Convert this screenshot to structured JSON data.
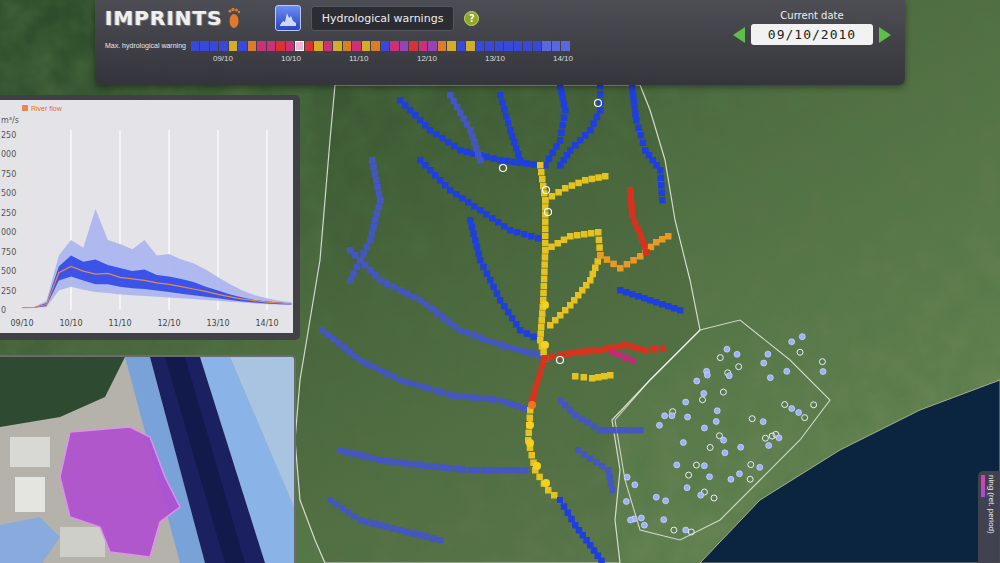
{
  "app": {
    "logo": "IMPRINTS"
  },
  "toolbar": {
    "layer_button": {
      "selected": true
    },
    "layer_menu": "Hydrological warnings",
    "help": "?"
  },
  "timeline": {
    "label": "Max. hydrological warning",
    "cells": [
      {
        "color": "#3848d8",
        "selected": false
      },
      {
        "color": "#3848d8",
        "selected": false
      },
      {
        "color": "#3848d8",
        "selected": false
      },
      {
        "color": "#3848d8",
        "selected": false
      },
      {
        "color": "#d2ae28",
        "selected": false
      },
      {
        "color": "#3848d8",
        "selected": false
      },
      {
        "color": "#dc7c24",
        "selected": false
      },
      {
        "color": "#cc3078",
        "selected": false
      },
      {
        "color": "#cc3078",
        "selected": false
      },
      {
        "color": "#d83234",
        "selected": false
      },
      {
        "color": "#cc3078",
        "selected": false
      },
      {
        "color": "#f0b4d4",
        "selected": true
      },
      {
        "color": "#d83234",
        "selected": false
      },
      {
        "color": "#d2ae28",
        "selected": false
      },
      {
        "color": "#cc3078",
        "selected": false
      },
      {
        "color": "#d2ae28",
        "selected": false
      },
      {
        "color": "#dc7c24",
        "selected": false
      },
      {
        "color": "#cc3078",
        "selected": false
      },
      {
        "color": "#d2ae28",
        "selected": false
      },
      {
        "color": "#dc7c24",
        "selected": false
      },
      {
        "color": "#3848d8",
        "selected": false
      },
      {
        "color": "#cc3078",
        "selected": false
      },
      {
        "color": "#9444b4",
        "selected": false
      },
      {
        "color": "#d83234",
        "selected": false
      },
      {
        "color": "#cc3078",
        "selected": false
      },
      {
        "color": "#9444b4",
        "selected": false
      },
      {
        "color": "#dc7c24",
        "selected": false
      },
      {
        "color": "#d2ae28",
        "selected": false
      },
      {
        "color": "#3848d8",
        "selected": false
      },
      {
        "color": "#d2ae28",
        "selected": false
      },
      {
        "color": "#3848d8",
        "selected": false
      },
      {
        "color": "#3848d8",
        "selected": false
      },
      {
        "color": "#3848d8",
        "selected": false
      },
      {
        "color": "#3848d8",
        "selected": false
      },
      {
        "color": "#3848d8",
        "selected": false
      },
      {
        "color": "#3848d8",
        "selected": false
      },
      {
        "color": "#3848d8",
        "selected": false
      },
      {
        "color": "#5a68dc",
        "selected": false
      },
      {
        "color": "#5a68dc",
        "selected": false
      },
      {
        "color": "#5a68dc",
        "selected": false
      }
    ],
    "ticks": [
      "09/10",
      "10/10",
      "11/10",
      "12/10",
      "13/10",
      "14/10"
    ]
  },
  "date": {
    "label": "Current date",
    "value": "09/10/2010"
  },
  "chart": {
    "legend": "River flow",
    "unit": "m³/s",
    "y_ticks": [
      "250",
      "000",
      "750",
      "500",
      "250",
      "000",
      "750",
      "500",
      "250",
      "0"
    ],
    "x_ticks": [
      "09/10",
      "10/10",
      "11/10",
      "12/10",
      "13/10",
      "14/10"
    ],
    "bands": [
      {
        "color": "#aab4f0",
        "upper": [
          30,
          40,
          120,
          700,
          900,
          800,
          1300,
          900,
          850,
          780,
          900,
          700,
          720,
          650,
          600,
          520,
          420,
          330,
          250,
          190,
          150,
          120,
          100
        ],
        "lower": [
          30,
          28,
          40,
          250,
          300,
          260,
          230,
          220,
          200,
          190,
          180,
          170,
          160,
          150,
          140,
          130,
          120,
          105,
          95,
          85,
          75,
          70,
          65
        ]
      },
      {
        "color": "#2f48e8",
        "upper": [
          30,
          35,
          90,
          560,
          700,
          620,
          650,
          580,
          540,
          500,
          520,
          450,
          430,
          400,
          360,
          300,
          250,
          200,
          160,
          130,
          110,
          95,
          85
        ],
        "lower": [
          30,
          30,
          50,
          380,
          430,
          380,
          330,
          330,
          300,
          280,
          270,
          250,
          230,
          210,
          190,
          170,
          150,
          130,
          110,
          95,
          85,
          75,
          70
        ]
      }
    ],
    "median": {
      "color": "#e8884a",
      "values": [
        30,
        32,
        70,
        480,
        560,
        500,
        460,
        470,
        420,
        400,
        380,
        350,
        330,
        300,
        270,
        240,
        200,
        170,
        140,
        120,
        100,
        90,
        80
      ]
    }
  },
  "rivers": [
    {
      "color": "#1d3ee0"
    },
    {
      "color": "#1d3ee0"
    },
    {
      "color": "#1d3ee0"
    },
    {
      "color": "#1d3ee0"
    },
    {
      "color": "#1d3ee0"
    },
    {
      "color": "#1d3ee0"
    },
    {
      "color": "#1d3ee0"
    },
    {
      "color": "#1d3ee0"
    },
    {
      "color": "#4456c4"
    },
    {
      "color": "#4456c4"
    },
    {
      "color": "#4456c4"
    },
    {
      "color": "#4456c4"
    },
    {
      "color": "#4456c4"
    },
    {
      "color": "#4456c4"
    },
    {
      "color": "#4456c4"
    },
    {
      "color": "#4456c4"
    },
    {
      "color": "#e6c21e"
    },
    {
      "color": "#e6c21e"
    },
    {
      "color": "#e6c21e"
    },
    {
      "color": "#e89a22"
    },
    {
      "color": "#d8321e"
    },
    {
      "color": "#d8321e"
    },
    {
      "color": "#c42a74"
    },
    {
      "color": "#e6c21e"
    },
    {
      "color": "#d8321e"
    },
    {
      "color": "#e6c21e"
    },
    {
      "color": "#1d3ee0"
    }
  ],
  "stations": [
    {
      "kind": "warning",
      "color": "#f2d21e"
    },
    {
      "kind": "warning",
      "color": "#f2d21e"
    },
    {
      "kind": "warning",
      "color": "#e87a1e"
    },
    {
      "kind": "warning",
      "color": "#f2d21e"
    },
    {
      "kind": "warning",
      "color": "#f2d21e"
    },
    {
      "kind": "warning",
      "color": "#f2d21e"
    },
    {
      "kind": "warning",
      "color": "#f2d21e"
    },
    {
      "kind": "gauge",
      "color": "#ffffff"
    },
    {
      "kind": "gauge",
      "color": "#ffffff"
    },
    {
      "kind": "gauge",
      "color": "#ffffff"
    },
    {
      "kind": "gauge",
      "color": "#ffffff"
    },
    {
      "kind": "gauge",
      "color": "#ffffff"
    }
  ],
  "legend": {
    "label": "ning (ret. period)"
  }
}
